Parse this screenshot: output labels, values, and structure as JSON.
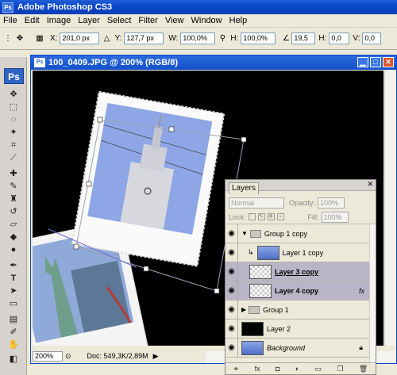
{
  "app": {
    "title": "Adobe Photoshop CS3",
    "logo": "Ps"
  },
  "menu": [
    "File",
    "Edit",
    "Image",
    "Layer",
    "Select",
    "Filter",
    "View",
    "Window",
    "Help"
  ],
  "options": {
    "x_label": "X:",
    "x_value": "201,0 px",
    "y_label": "Y:",
    "y_value": "127,7 px",
    "w_label": "W:",
    "w_value": "100,0%",
    "h_label": "H:",
    "h_value": "100,0%",
    "angle_value": "19,5",
    "h2_label": "H:",
    "h2_value": "0,0",
    "v_label": "V:",
    "v_value": "0,0"
  },
  "document": {
    "title": "100_0409.JPG @ 200% (RGB/8)",
    "zoom": "200%",
    "doc_info": "Doc: 549,3K/2,89M"
  },
  "layers_panel": {
    "tab": "Layers",
    "blend_mode": "Normal",
    "opacity_label": "Opacity:",
    "opacity_value": "100%",
    "lock_label": "Lock:",
    "fill_label": "Fill:",
    "fill_value": "100%",
    "layers": [
      {
        "name": "Group 1 copy",
        "kind": "group"
      },
      {
        "name": "Layer 1 copy",
        "kind": "layer"
      },
      {
        "name": "Layer 3 copy",
        "kind": "layer"
      },
      {
        "name": "Layer 4 copy",
        "kind": "layer",
        "fx": "fx"
      },
      {
        "name": "Group 1",
        "kind": "group"
      },
      {
        "name": "Layer 2",
        "kind": "layer"
      },
      {
        "name": "Background",
        "kind": "background"
      }
    ]
  }
}
